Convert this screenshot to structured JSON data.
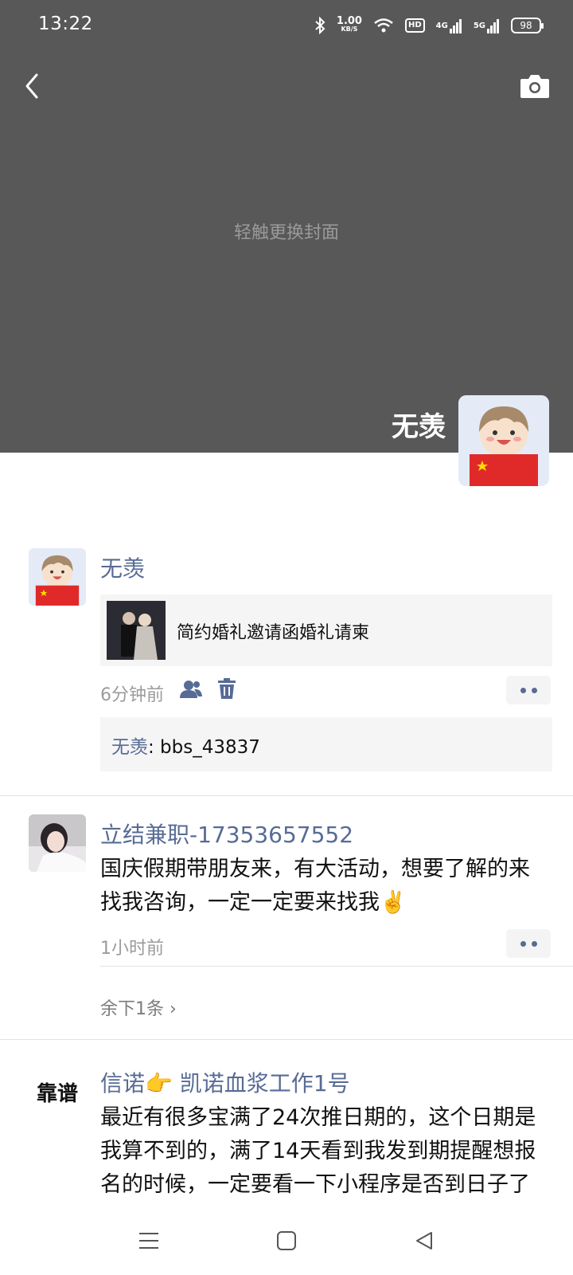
{
  "status_bar": {
    "time": "13:22",
    "speed_value": "1.00",
    "speed_unit": "KB/S",
    "hd_label": "HD",
    "net1": "4G",
    "net2": "5G",
    "battery": "98"
  },
  "cover": {
    "hint": "轻触更换封面",
    "profile_name": "无羡"
  },
  "posts": [
    {
      "author": "无羡",
      "link_title": "简约婚礼邀请函婚礼请柬",
      "time": "6分钟前",
      "comment_name": "无羡",
      "comment_text": ": bbs_43837"
    },
    {
      "author": "立结兼职-17353657552",
      "text": "国庆假期带朋友来，有大活动，想要了解的来找我咨询，一定一定要来找我✌️",
      "time": "1小时前",
      "remaining": "余下1条 ›"
    },
    {
      "author": "信诺👉 凯诺血浆工作1号",
      "avatar_text": "靠谱",
      "text": "最近有很多宝满了24次推日期的，这个日期是我算不到的，满了14天看到我发到期提醒想报名的时候，一定要看一下小程序是否到日子了哈！！小程序不到日子的话"
    }
  ],
  "colors": {
    "cover_bg": "#585858",
    "link_blue": "#576b95",
    "card_bg": "#f5f5f5"
  }
}
